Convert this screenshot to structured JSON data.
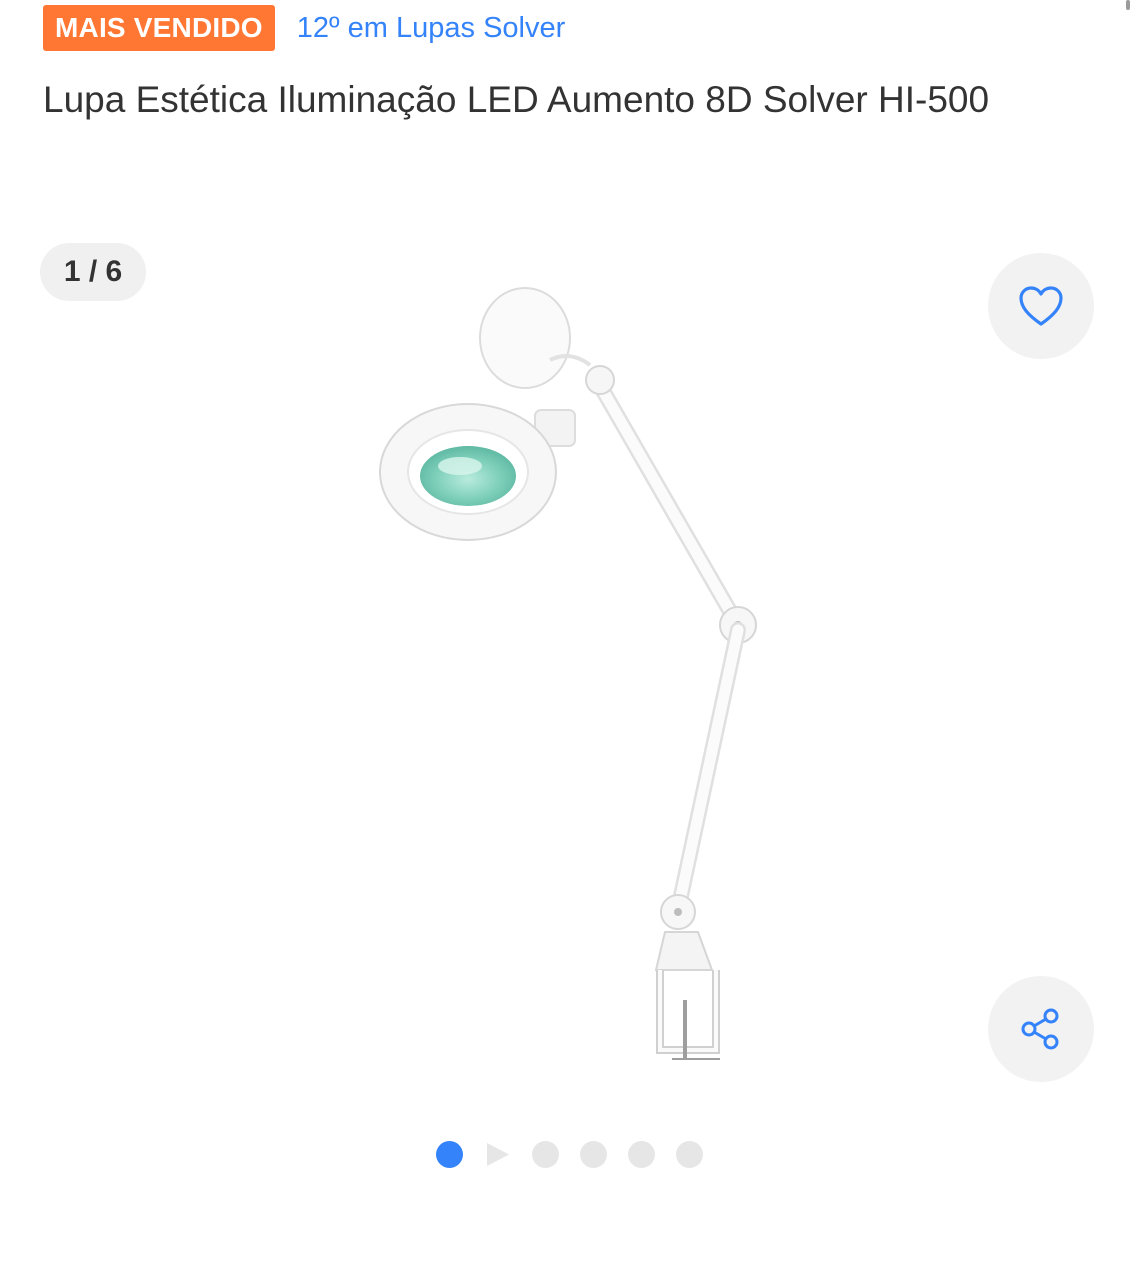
{
  "badge": {
    "label": "MAIS VENDIDO",
    "color": "#ff7733"
  },
  "ranking": {
    "text": "12º em Lupas Solver",
    "color": "#3483fa"
  },
  "product": {
    "title": "Lupa Estética Iluminação LED Aumento 8D Solver HI-500"
  },
  "gallery": {
    "counter": "1 / 6",
    "current_index": 1,
    "total": 6,
    "favorite_icon": "heart-icon",
    "share_icon": "share-icon",
    "image_subject": "magnifying-lamp-with-arm-and-clamp",
    "pagination": [
      {
        "type": "image",
        "active": true
      },
      {
        "type": "video",
        "active": false
      },
      {
        "type": "image",
        "active": false
      },
      {
        "type": "image",
        "active": false
      },
      {
        "type": "image",
        "active": false
      },
      {
        "type": "image",
        "active": false
      }
    ]
  },
  "colors": {
    "accent": "#3483fa",
    "text": "#333333",
    "button_bg": "#f2f2f2",
    "dot_inactive": "#e6e6e6"
  }
}
